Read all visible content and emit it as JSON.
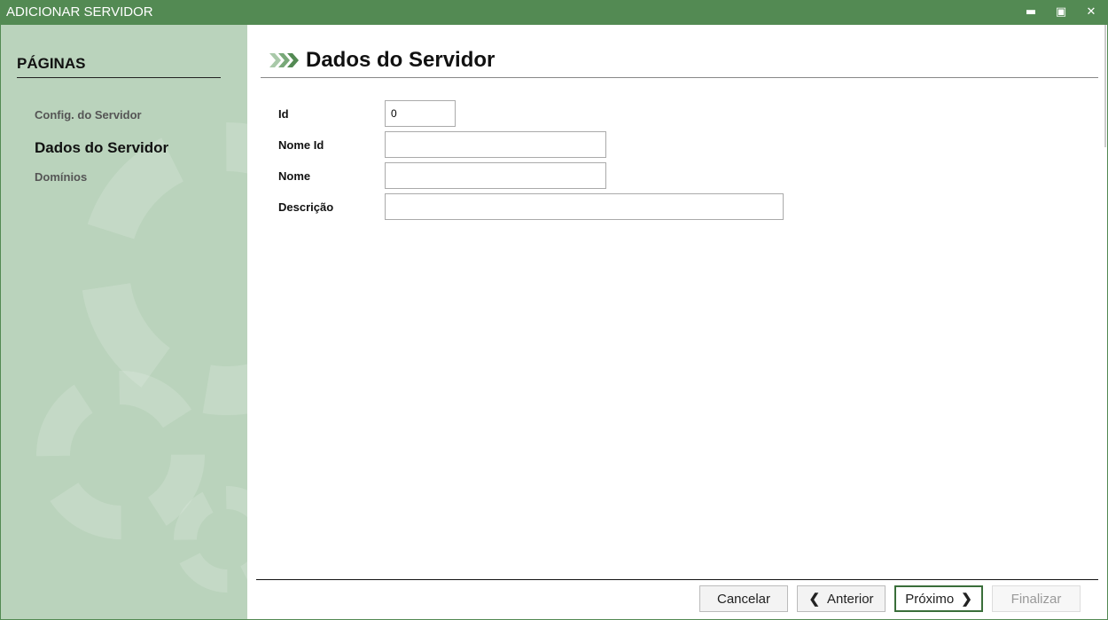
{
  "window": {
    "title": "ADICIONAR SERVIDOR"
  },
  "sidebar": {
    "heading": "PÁGINAS",
    "items": [
      {
        "label": "Config. do Servidor"
      },
      {
        "label": "Dados do Servidor"
      },
      {
        "label": "Domínios"
      }
    ]
  },
  "main": {
    "title": "Dados do Servidor",
    "fields": [
      {
        "label": "Id",
        "value": "0"
      },
      {
        "label": "Nome Id",
        "value": ""
      },
      {
        "label": "Nome",
        "value": ""
      },
      {
        "label": "Descrição",
        "value": ""
      }
    ]
  },
  "footer": {
    "cancel": "Cancelar",
    "previous": "Anterior",
    "next": "Próximo",
    "finish": "Finalizar"
  },
  "colors": {
    "accent": "#538a53",
    "sidebar": "#bad3bc"
  }
}
